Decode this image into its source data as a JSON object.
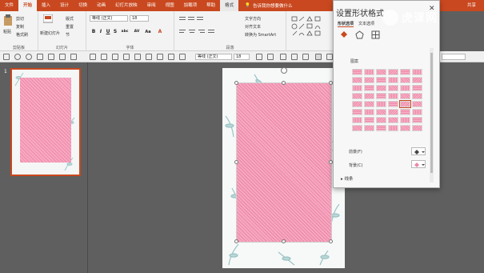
{
  "menu": {
    "tabs": [
      "文件",
      "开始",
      "插入",
      "设计",
      "切换",
      "动画",
      "幻灯片放映",
      "审阅",
      "视图",
      "加载项",
      "帮助",
      "格式"
    ],
    "active_tab": "开始",
    "search": "告诉我你想要做什么",
    "share": "共享"
  },
  "ribbon": {
    "clipboard": {
      "paste": "粘贴",
      "cut": "剪切",
      "copy": "复制",
      "format_painter": "格式刷",
      "label": "剪贴板"
    },
    "slides": {
      "new_slide": "新建幻灯片",
      "layout": "版式",
      "reset": "重置",
      "section": "节",
      "label": "幻灯片"
    },
    "font": {
      "font_name": "等线 (正文)",
      "font_size": "18",
      "label": "字体",
      "bold": "B",
      "italic": "I",
      "underline": "U",
      "strike": "S",
      "shadow": "abc",
      "spacing": "AV",
      "case": "Aa",
      "color": "A"
    },
    "paragraph": {
      "text_direction": "文字方向",
      "align_text": "对齐文本",
      "smartart": "转换为 SmartArt",
      "label": "段落"
    },
    "drawing": {
      "label": ""
    }
  },
  "toolbar": {
    "font_name": "等线 (正文)",
    "font_size": "18"
  },
  "thumb": {
    "number": "1"
  },
  "pane": {
    "title": "设置形状格式",
    "tabs": [
      "形状选项",
      "文本选项"
    ],
    "section_fill": "图案",
    "pattern_rows": 8,
    "pattern_cols": 6,
    "foreground_label": "前景(F)",
    "background_label": "背景(C)",
    "line_label": "线条"
  },
  "colors": {
    "accent": "#c9481f",
    "pattern_pink": "#ef86a6",
    "slide_bg": "#f6f9f8"
  },
  "watermark": {
    "text": "虎课网"
  }
}
